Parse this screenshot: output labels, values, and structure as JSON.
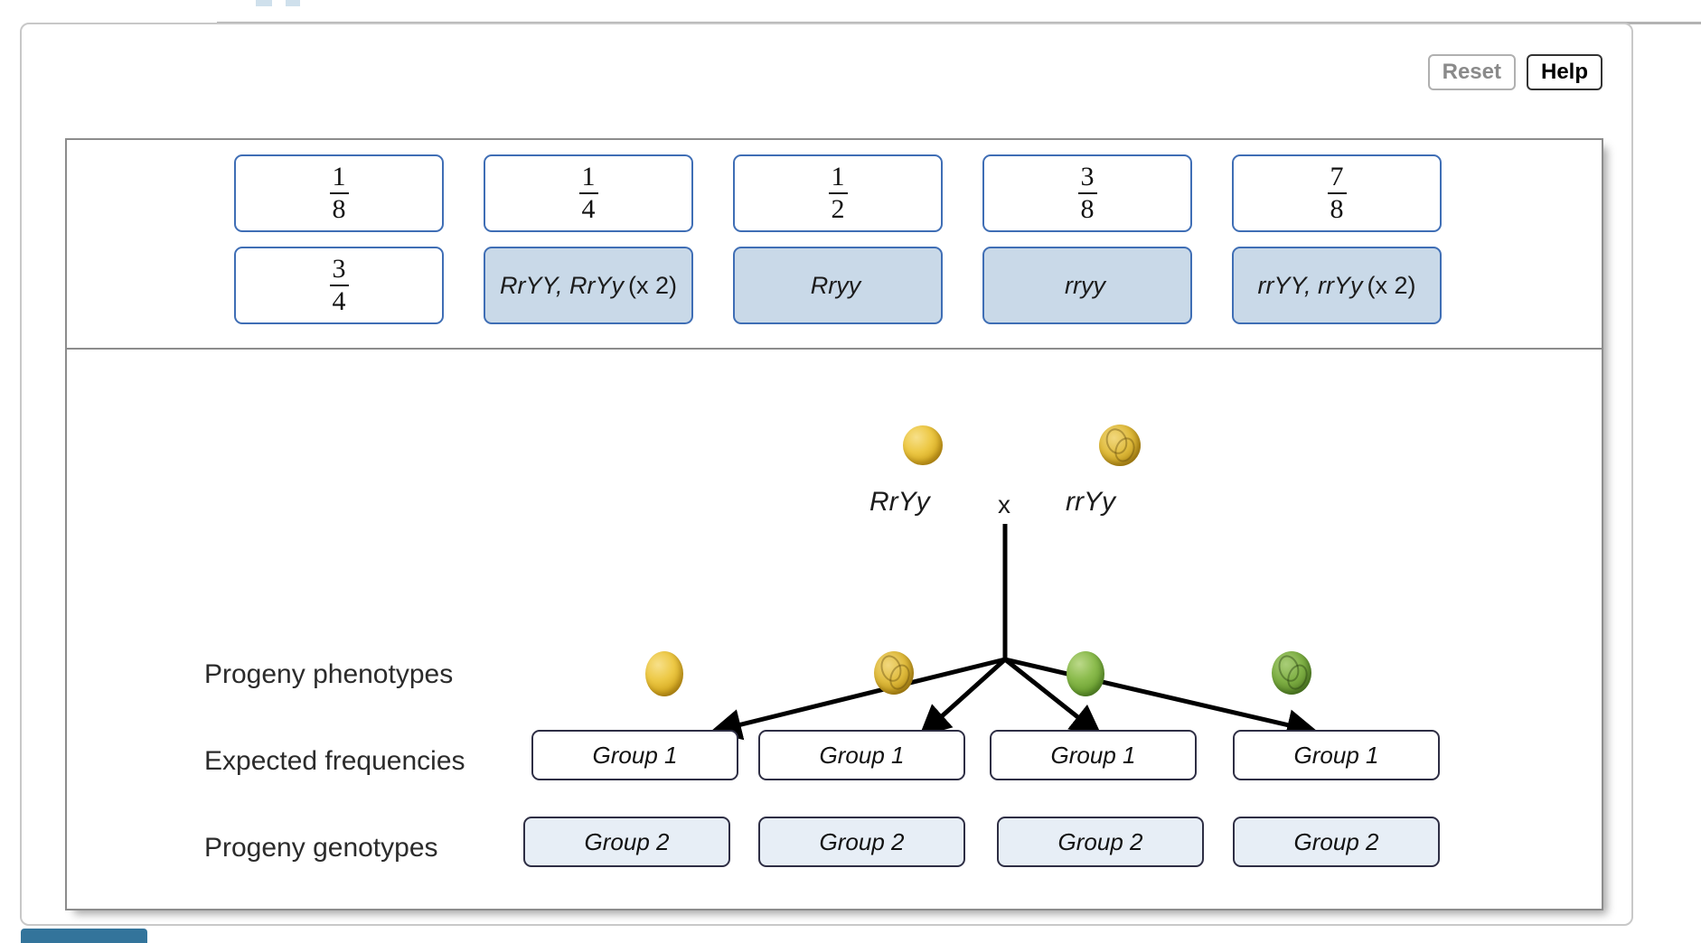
{
  "toolbar": {
    "reset_label": "Reset",
    "help_label": "Help"
  },
  "tile_bank": {
    "fraction_tiles": [
      {
        "numerator": "1",
        "denominator": "8"
      },
      {
        "numerator": "1",
        "denominator": "4"
      },
      {
        "numerator": "1",
        "denominator": "2"
      },
      {
        "numerator": "3",
        "denominator": "8"
      },
      {
        "numerator": "7",
        "denominator": "8"
      },
      {
        "numerator": "3",
        "denominator": "4"
      }
    ],
    "genotype_tiles": [
      {
        "genotype": "RrYY, RrYy",
        "multiplier": "(x 2)"
      },
      {
        "genotype": "Rryy",
        "multiplier": ""
      },
      {
        "genotype": "rryy",
        "multiplier": ""
      },
      {
        "genotype": "rrYY, rrYy",
        "multiplier": "(x 2)"
      }
    ]
  },
  "cross": {
    "parent_left_genotype": "RrYy",
    "cross_symbol": "x",
    "parent_right_genotype": "rrYy",
    "parent_left_phenotype": "round-yellow-pea",
    "parent_right_phenotype": "wrinkled-yellow-pea"
  },
  "rows": {
    "phenotypes_label": "Progeny phenotypes",
    "frequencies_label": "Expected frequencies",
    "genotypes_label": "Progeny genotypes"
  },
  "progeny": [
    {
      "phenotype_icon": "round-yellow-pea",
      "frequency_placeholder": "Group 1",
      "genotype_placeholder": "Group 2"
    },
    {
      "phenotype_icon": "wrinkled-yellow-pea",
      "frequency_placeholder": "Group 1",
      "genotype_placeholder": "Group 2"
    },
    {
      "phenotype_icon": "round-green-pea",
      "frequency_placeholder": "Group 1",
      "genotype_placeholder": "Group 2"
    },
    {
      "phenotype_icon": "wrinkled-green-pea",
      "frequency_placeholder": "Group 1",
      "genotype_placeholder": "Group 2"
    }
  ],
  "colors": {
    "tile_border": "#3f6eb5",
    "genotype_tile_fill": "#c9d9e8",
    "dropzone_border": "#2e2e44",
    "dropzone_g2_fill": "#e7eef6",
    "panel_border": "#8c8c8c",
    "accent_button": "#33749b"
  }
}
